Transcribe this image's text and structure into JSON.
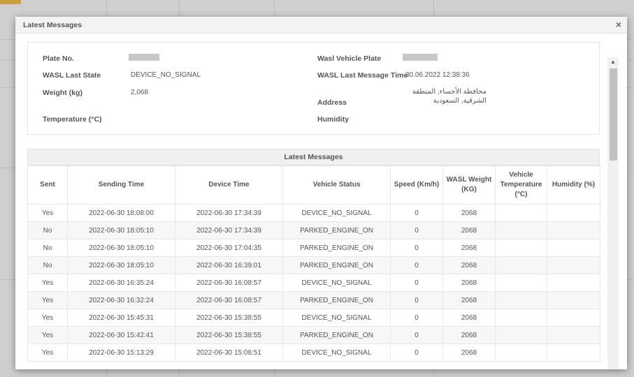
{
  "modal": {
    "title": "Latest Messages",
    "close_icon": "×"
  },
  "info": {
    "plate_no_label": "Plate No.",
    "wasl_state_label": "WASL Last State",
    "wasl_state_value": "DEVICE_NO_SIGNAL",
    "weight_label": "Weight (kg)",
    "weight_value": "2,068",
    "temperature_label": "Temperature (°C)",
    "wasl_vehicle_plate_label": "Wasl Vehicle Plate",
    "wasl_last_msg_time_label": "WASL Last Message Time",
    "wasl_last_msg_time_value": "30.06.2022 12:38:36",
    "address_label": "Address",
    "address_value": "محافظة الأحساء, المنطقة الشرقية, السعودية",
    "humidity_label": "Humidity"
  },
  "table": {
    "caption": "Latest Messages",
    "headers": [
      "Sent",
      "Sending Time",
      "Device Time",
      "Vehicle Status",
      "Speed (Km/h)",
      "WASL Weight (KG)",
      "Vehicle Temperature (°C)",
      "Humidity (%)"
    ],
    "rows": [
      [
        "Yes",
        "2022-06-30 18:08:00",
        "2022-06-30 17:34:39",
        "DEVICE_NO_SIGNAL",
        "0",
        "2068",
        "",
        ""
      ],
      [
        "No",
        "2022-06-30 18:05:10",
        "2022-06-30 17:34:39",
        "PARKED_ENGINE_ON",
        "0",
        "2068",
        "",
        ""
      ],
      [
        "No",
        "2022-06-30 18:05:10",
        "2022-06-30 17:04:35",
        "PARKED_ENGINE_ON",
        "0",
        "2068",
        "",
        ""
      ],
      [
        "No",
        "2022-06-30 18:05:10",
        "2022-06-30 16:39:01",
        "PARKED_ENGINE_ON",
        "0",
        "2068",
        "",
        ""
      ],
      [
        "Yes",
        "2022-06-30 16:35:24",
        "2022-06-30 16:08:57",
        "DEVICE_NO_SIGNAL",
        "0",
        "2068",
        "",
        ""
      ],
      [
        "Yes",
        "2022-06-30 16:32:24",
        "2022-06-30 16:08:57",
        "PARKED_ENGINE_ON",
        "0",
        "2068",
        "",
        ""
      ],
      [
        "Yes",
        "2022-06-30 15:45:31",
        "2022-06-30 15:38:55",
        "DEVICE_NO_SIGNAL",
        "0",
        "2068",
        "",
        ""
      ],
      [
        "Yes",
        "2022-06-30 15:42:41",
        "2022-06-30 15:38:55",
        "PARKED_ENGINE_ON",
        "0",
        "2068",
        "",
        ""
      ],
      [
        "Yes",
        "2022-06-30 15:13:29",
        "2022-06-30 15:08:51",
        "DEVICE_NO_SIGNAL",
        "0",
        "2068",
        "",
        ""
      ]
    ]
  },
  "scrollbar": {
    "up_icon": "▲",
    "down_icon": "▼"
  }
}
